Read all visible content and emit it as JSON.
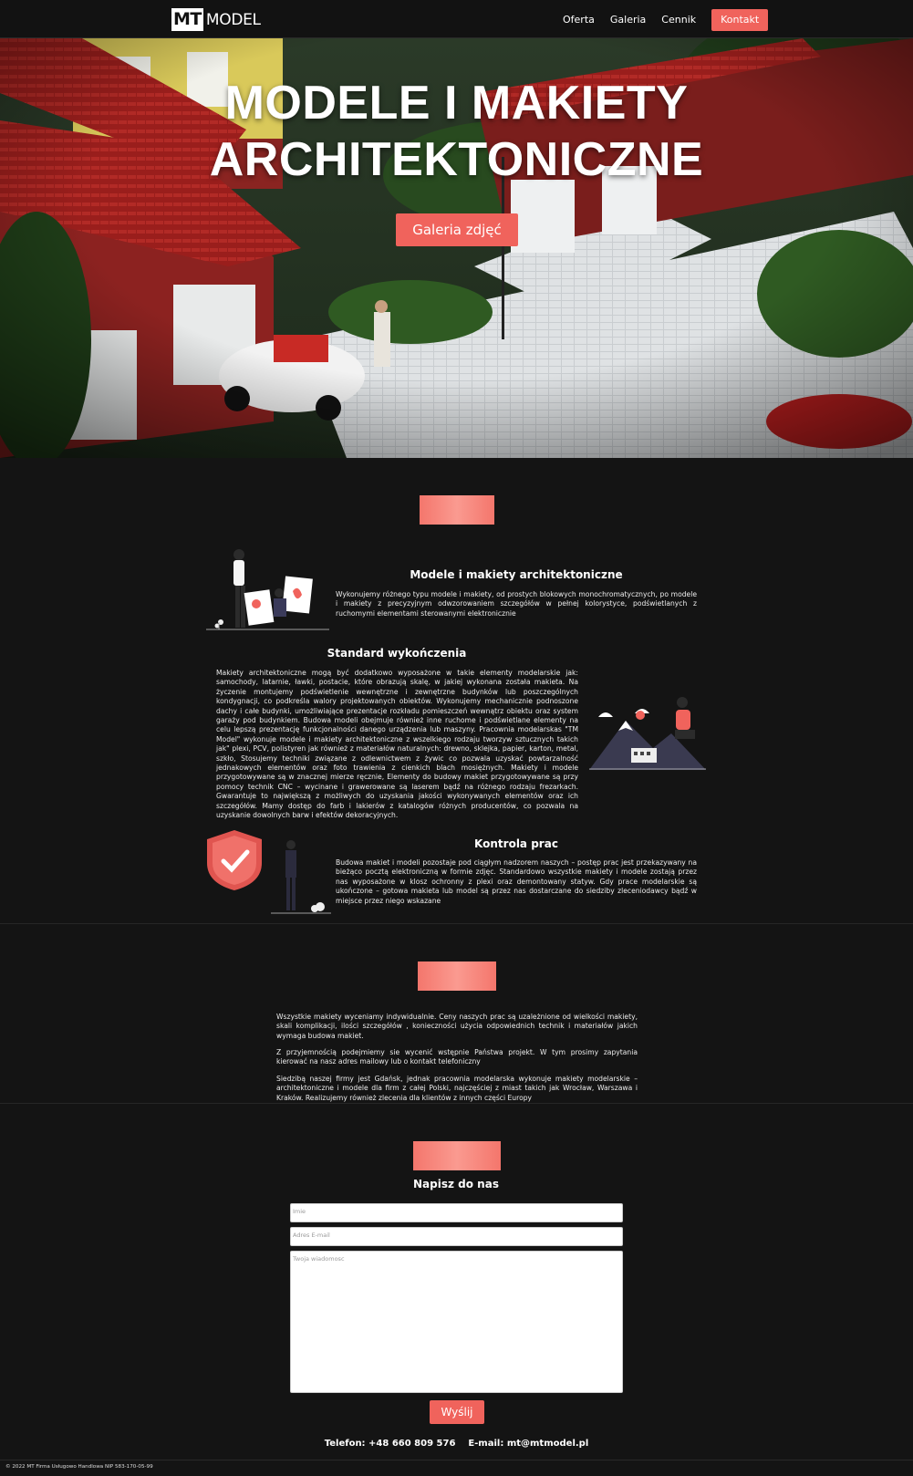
{
  "nav": {
    "logo_mark": "MT",
    "logo_text": "MODEL",
    "links": [
      "Oferta",
      "Galeria",
      "Cennik"
    ],
    "cta": "Kontakt"
  },
  "hero": {
    "title_line1": "MODELE I MAKIETY",
    "title_line2": "ARCHITEKTONICZNE",
    "button": "Galeria zdjęć"
  },
  "offer": {
    "items": [
      {
        "title": "Modele i makiety architektoniczne",
        "text": "Wykonujemy różnego typu modele i makiety, od prostych blokowych monochromatycznych, po modele i makiety z precyzyjnym odwzorowaniem szczegółów w pełnej kolorystyce, podświetlanych z ruchomymi elementami sterowanymi elektronicznie"
      },
      {
        "title": "Standard wykończenia",
        "text": "Makiety architektoniczne mogą być dodatkowo wyposażone w takie elementy modelarskie jak: samochody, latarnie, ławki, postacie, które obrazują skalę, w jakiej wykonana została makieta. Na życzenie montujemy podświetlenie wewnętrzne i zewnętrzne budynków lub poszczególnych kondygnacji, co podkreśla walory projektowanych obiektów. Wykonujemy mechanicznie podnoszone dachy i całe budynki, umożliwiające prezentacje rozkładu pomieszczeń wewnątrz obiektu oraz system garaży pod budynkiem. Budowa modeli obejmuje również inne ruchome i podświetlane elementy na celu lepszą prezentację funkcjonalności danego urządzenia lub maszyny. Pracownia modelarskas \"TM Model\" wykonuje modele i makiety architektoniczne z wszelkiego rodzaju tworzyw sztucznych takich jak\" plexi, PCV, polistyren jak również z materiałów naturalnych: drewno, sklejka, papier, karton, metal, szkło, Stosujemy techniki związane z odlewnictwem z żywic co pozwala uzyskać powtarzalność jednakowych elementów oraz foto trawienia z cienkich blach mosiężnych. Makiety i modele przygotowywane są w znacznej mierze ręcznie, Elementy do budowy makiet przygotowywane są przy pomocy technik CNC – wycinane i grawerowane są laserem bądź na różnego rodzaju frezarkach. Gwarantuje to największą z możliwych do uzyskania jakości wykonywanych elementów oraz ich szczegółów. Mamy dostęp do farb i lakierów z katalogów różnych producentów, co pozwala na uzyskanie dowolnych barw i efektów dekoracyjnych."
      },
      {
        "title": "Kontrola prac",
        "text": "Budowa makiet i modeli pozostaje pod ciągłym nadzorem naszych – postęp prac jest przekazywany na bieżąco pocztą elektroniczną w formie zdjęc. Standardowo wszystkie makiety i modele zostają przez nas wyposażone w klosz ochronny z plexi oraz demontowany statyw. Gdy prace modelarskie są ukończone – gotowa makieta lub model są przez nas dostarczane do siedziby zleceniodawcy bądź w miejsce przez niego wskazane"
      }
    ]
  },
  "pricing": {
    "paragraphs": [
      "Wszystkie makiety wyceniamy indywidualnie. Ceny naszych prac są uzależnione od wielkości makiety, skali komplikacji, ilości szczegółów , konieczności użycia odpowiednich technik i materiałów jakich wymaga budowa makiet.",
      "Z przyjemnością podejmiemy sie wycenić wstępnie Państwa projekt. W tym prosimy zapytania kierować na nasz adres mailowy lub o kontakt telefoniczny",
      "Siedzibą naszej firmy jest Gdańsk, jednak pracownia modelarska wykonuje makiety modelarskie – architektoniczne i modele dla firm z całej Polski, najczęściej z miast takich jak Wrocław, Warszawa i Kraków. Realizujemy również zlecenia dla klientów z innych części Europy"
    ]
  },
  "contact": {
    "title": "Napisz do nas",
    "name_placeholder": "Imie",
    "email_placeholder": "Adres E-mail",
    "message_placeholder": "Twoja wiadomosc",
    "send": "Wyślij",
    "phone_line": "Telefon: +48 660 809 576    E-mail: mt@mtmodel.pl"
  },
  "footer": {
    "text": "© 2022 MT Firma Usługowo Handlowa NIP 583-170-05-99"
  },
  "colors": {
    "accent": "#f0635c",
    "background": "#141414"
  }
}
